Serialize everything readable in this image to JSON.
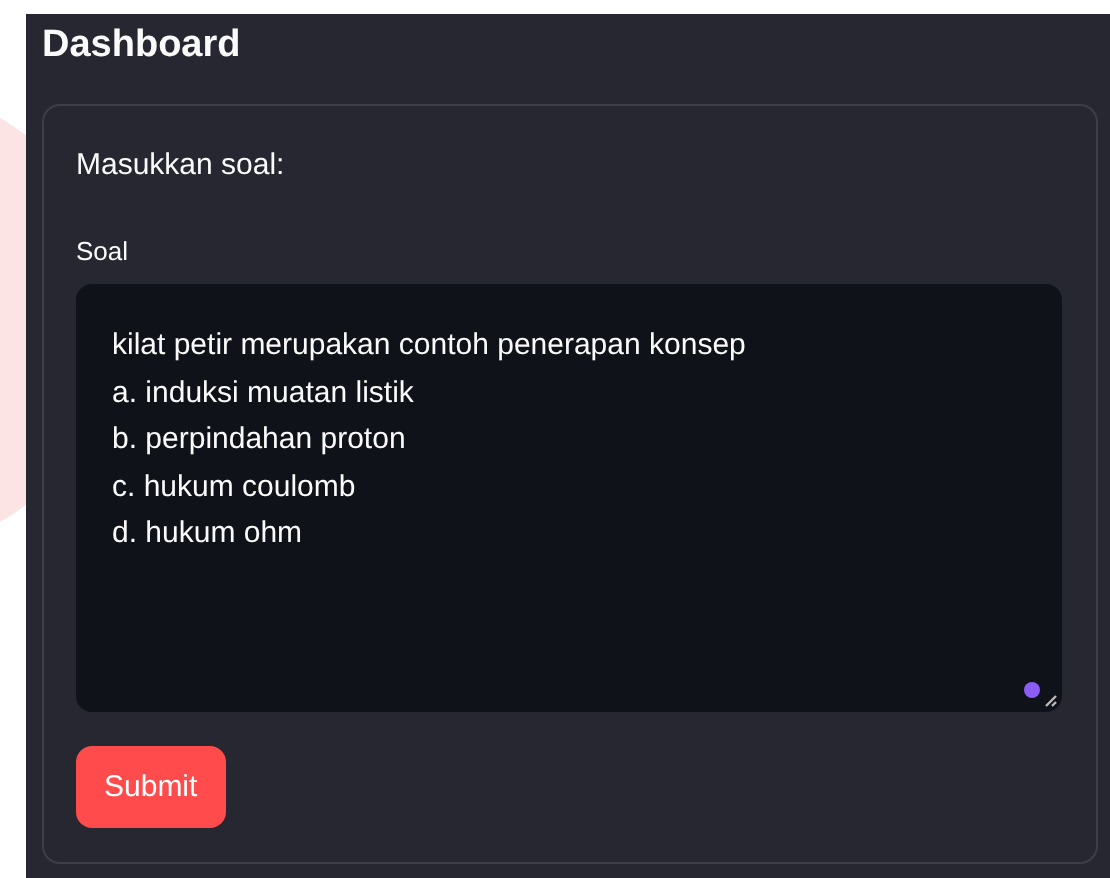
{
  "page": {
    "title": "Dashboard"
  },
  "form": {
    "heading": "Masukkan soal:",
    "field_label": "Soal",
    "field_value": "kilat petir merupakan contoh penerapan konsep\na. induksi muatan listik\nb. perpindahan proton\nc. hukum coulomb\nd. hukum ohm",
    "submit_label": "Submit"
  }
}
